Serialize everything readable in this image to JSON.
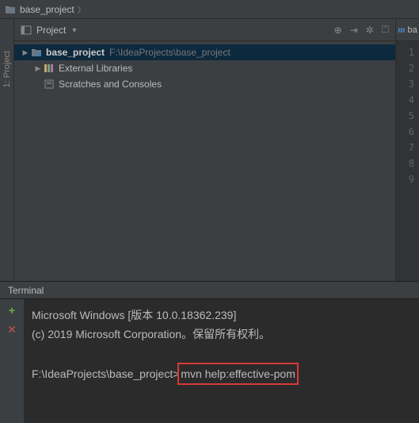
{
  "breadcrumb": {
    "project_name": "base_project"
  },
  "sidebar_rail": {
    "label": "1: Project"
  },
  "project_panel": {
    "title": "Project",
    "root": {
      "name": "base_project",
      "path": "F:\\IdeaProjects\\base_project"
    },
    "external_libs": "External Libraries",
    "scratches": "Scratches and Consoles"
  },
  "editor": {
    "tab_prefix": "m",
    "tab_suffix": "ba",
    "line_numbers": [
      "1",
      "2",
      "3",
      "4",
      "5",
      "6",
      "7",
      "8",
      "9"
    ]
  },
  "terminal": {
    "title": "Terminal",
    "line1": "Microsoft Windows [版本 10.0.18362.239]",
    "line2": "(c) 2019 Microsoft Corporation。保留所有权利。",
    "prompt": "F:\\IdeaProjects\\base_project>",
    "command": "mvn help:effective-pom"
  }
}
